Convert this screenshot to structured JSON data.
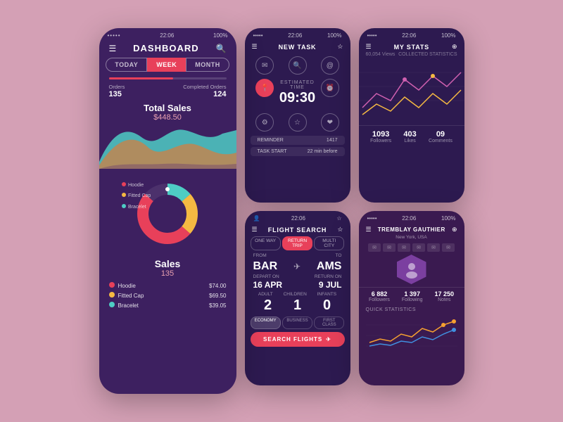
{
  "background_color": "#d4a0b5",
  "dashboard": {
    "status_time": "22:06",
    "status_battery": "100%",
    "title": "DASHBOARD",
    "tabs": [
      "TODAY",
      "WEEK",
      "MONTH"
    ],
    "active_tab": "WEEK",
    "orders_label": "Orders",
    "orders_value": "135",
    "completed_label": "Completed Orders",
    "completed_value": "124",
    "total_sales_label": "Total Sales",
    "total_sales_amount": "$448.50",
    "sales_label": "Sales",
    "sales_number": "135",
    "legend": [
      {
        "name": "Hoodie",
        "color": "#e8405a",
        "price": "$74.00"
      },
      {
        "name": "Fitted Cap",
        "color": "#f5b942",
        "price": "$69.50"
      },
      {
        "name": "Bracelet",
        "color": "#4ecdc4",
        "price": "$39.05"
      }
    ]
  },
  "new_task": {
    "title": "NEW TASK",
    "time_label": "ESTIMATED TIME",
    "time_value": "09:30",
    "reminder_label": "REMINDER",
    "reminder_value": "1417",
    "task_start_label": "TASK START",
    "task_start_value": "22 min before",
    "icons": [
      "✉",
      "🔍",
      "@",
      "📍",
      "⏰",
      "☆",
      "⚙",
      "❤"
    ]
  },
  "my_stats": {
    "title": "MY STATS",
    "views_label": "60,054 Views",
    "subtitle": "COLLECTED STATISTICS",
    "followers": "1093",
    "followers_label": "Followers",
    "likes": "403",
    "likes_label": "Likes",
    "comments": "09",
    "comments_label": "Comments"
  },
  "flight_search": {
    "title": "FLIGHT SEARCH",
    "trip_types": [
      "ONE WAY",
      "RETURN TRIP",
      "MULTI CITY"
    ],
    "active_trip": "RETURN TRIP",
    "from_label": "FROM",
    "from_code": "BAR",
    "to_label": "TO",
    "to_code": "AMS",
    "depart_label": "DEPART ON",
    "depart_value": "16 APR",
    "return_label": "RETURN ON",
    "return_value": "9 JUL",
    "adult_label": "ADULT",
    "adult_value": "2",
    "children_label": "CHILDREN",
    "children_value": "1",
    "infants_label": "INFANTS",
    "infants_value": "0",
    "classes": [
      "ECONOMY",
      "BUSINESS",
      "FIRST CLASS"
    ],
    "active_class": "ECONOMY",
    "search_label": "SEARCH FLIGHTS"
  },
  "profile": {
    "title": "TREMBLAY GAUTHIER",
    "location": "New York, USA",
    "followers_value": "6 882",
    "followers_label": "Followers",
    "following_value": "1 397",
    "following_label": "Following",
    "notes_value": "17 250",
    "notes_label": "Notes",
    "quick_stats_label": "QUICK STATISTICS"
  }
}
